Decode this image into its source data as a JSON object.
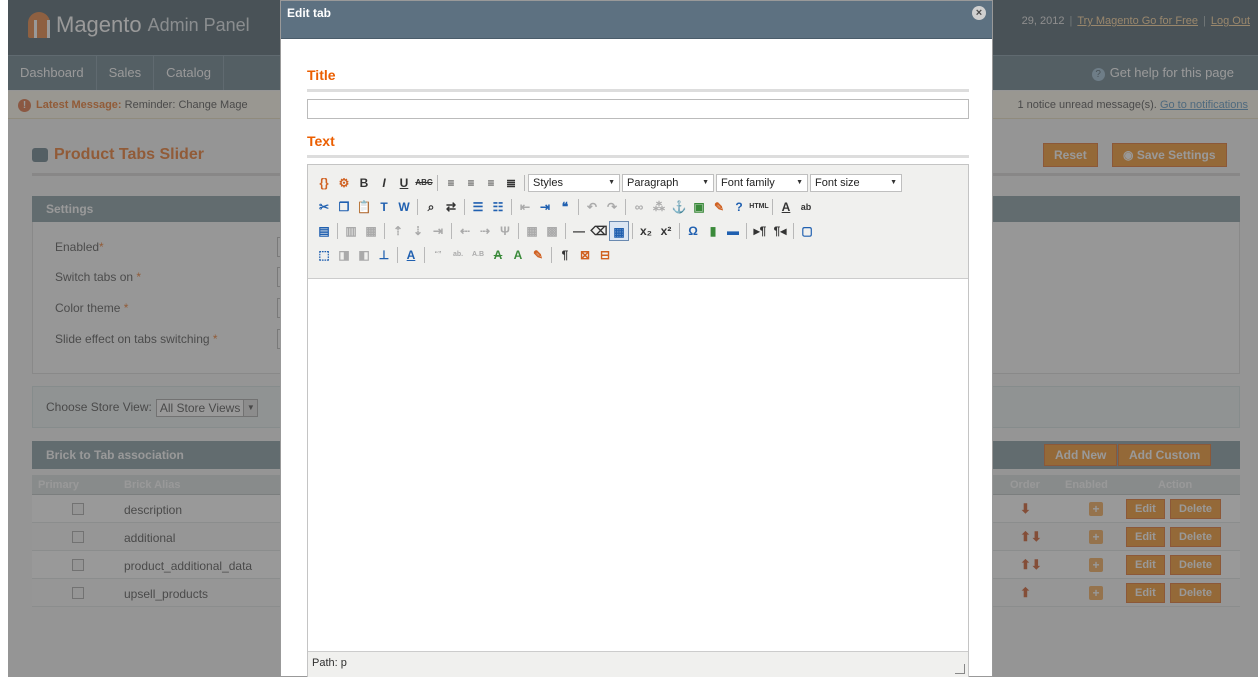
{
  "header": {
    "brand": "Magento",
    "brand_sub": "Admin Panel",
    "date_fragment": "29, 2012",
    "try_link": "Try Magento Go for Free",
    "logout_link": "Log Out"
  },
  "nav": {
    "items": [
      "Dashboard",
      "Sales",
      "Catalog"
    ],
    "help": "Get help for this page"
  },
  "message": {
    "label": "Latest Message:",
    "text": "Reminder: Change Mage",
    "right_text": "1 notice unread message(s).",
    "right_link": "Go to notifications"
  },
  "page": {
    "title": "Product Tabs Slider",
    "reset": "Reset",
    "save": "Save Settings"
  },
  "settings": {
    "header": "Settings",
    "fields": [
      {
        "label": "Enabled",
        "required": "*"
      },
      {
        "label": "Switch tabs on",
        "required": "*"
      },
      {
        "label": "Color theme",
        "required": "*"
      },
      {
        "label": "Slide effect on tabs switching",
        "required": "*"
      }
    ]
  },
  "store": {
    "label": "Choose Store View:",
    "value": "All Store Views"
  },
  "grid": {
    "header": "Brick to Tab association",
    "add_new": "Add New",
    "add_custom": "Add Custom",
    "columns": {
      "primary": "Primary",
      "alias": "Brick Alias",
      "order": "Order",
      "enabled": "Enabled",
      "action": "Action"
    },
    "rows": [
      {
        "alias": "description",
        "arrows": "⬇"
      },
      {
        "alias": "additional",
        "arrows": "⬆⬇"
      },
      {
        "alias": "product_additional_data",
        "arrows": "⬆⬇"
      },
      {
        "alias": "upsell_products",
        "arrows": "⬆"
      }
    ],
    "edit": "Edit",
    "delete": "Delete",
    "plus": "+"
  },
  "modal": {
    "title": "Edit tab",
    "close": "×",
    "title_label": "Title",
    "title_value": "",
    "text_label": "Text",
    "path": "Path: p",
    "dropdowns": {
      "styles": "Styles",
      "format": "Paragraph",
      "font_family": "Font family",
      "font_size": "Font size"
    }
  },
  "colors": {
    "accent": "#eb5e00",
    "header": "#2d4451",
    "button": "#f18200"
  }
}
